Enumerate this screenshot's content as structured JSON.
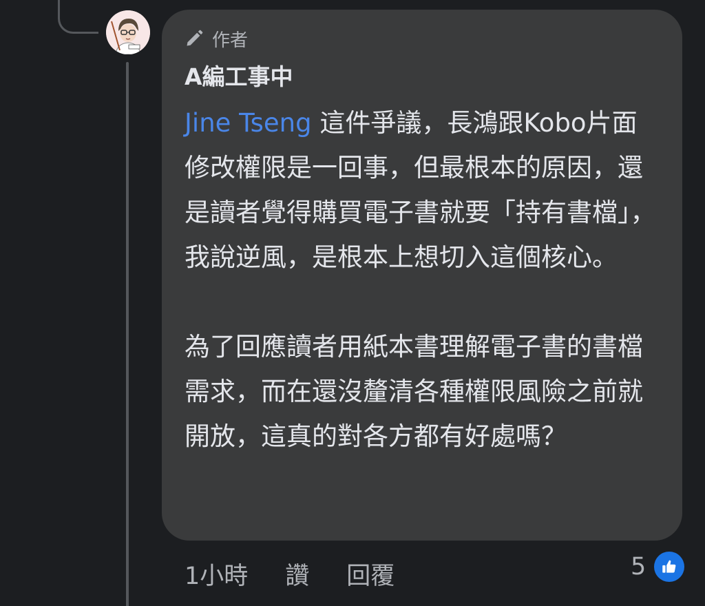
{
  "comment": {
    "badge_label": "作者",
    "author_name": "A編工事中",
    "mention": "Jine Tseng",
    "paragraph1_rest": " 這件爭議，長鴻跟Kobo片面修改權限是一回事，但最根本的原因，還是讀者覺得購買電子書就要「持有書檔」，我說逆風，是根本上想切入這個核心。",
    "paragraph2": "為了回應讀者用紙本書理解電子書的書檔需求，而在還沒釐清各種權限風險之前就開放，這真的對各方都有好處嗎？"
  },
  "actions": {
    "time": "1小時",
    "like": "讚",
    "reply": "回覆"
  },
  "reactions": {
    "count": "5"
  },
  "colors": {
    "background": "#1c1e21",
    "bubble": "#3a3b3c",
    "mention": "#4a86e8",
    "like_badge": "#1b74e4"
  }
}
